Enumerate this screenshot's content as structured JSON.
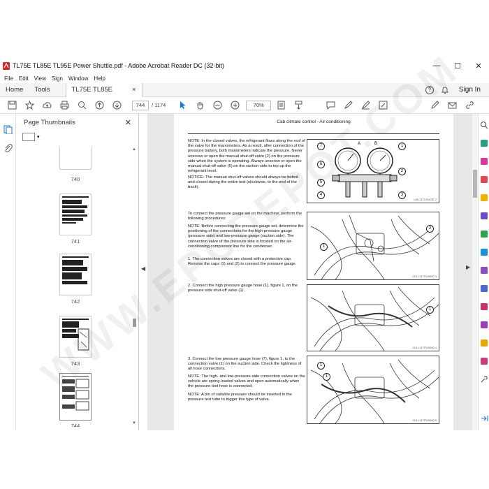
{
  "window": {
    "title": "TL75E TL85E TL95E Power Shuttle.pdf - Adobe Acrobat Reader DC (32-bit)",
    "minimize": "—",
    "maximize": "☐",
    "close": "✕"
  },
  "menu": [
    "File",
    "Edit",
    "View",
    "Sign",
    "Window",
    "Help"
  ],
  "tabs": {
    "home": "Home",
    "tools": "Tools",
    "doc": "TL75E TL85E TL95E...",
    "doc_close": "×",
    "help": "?",
    "bell": "🔔",
    "signin": "Sign In"
  },
  "toolbar": {
    "page_current": "744",
    "page_total": "/ 1174",
    "zoom": "70%"
  },
  "panel": {
    "title": "Page Thumbnails",
    "close": "✕",
    "thumbnails": [
      "740",
      "741",
      "742",
      "743",
      "744"
    ]
  },
  "document": {
    "header": "Cab climate control - Air conditioning",
    "note1": "NOTE: In the closed valves, the refrigerant flows along the roof of the valve for the manometers. As a result, after connection of the pressure battery, both manometers indicate the pressure. Never unscrew or open the manual shut-off valve (2) on the pressure side when the system is operating. Always unscrew or open the manual shut-off valve (6) on the suction side to top up the refrigerant level.",
    "notice": "NOTICE: The manual shut-off valves should always be bolted and closed during the entire test (clockwise, to the end of the track).",
    "intro": "To connect the pressure gauge set on the machine, perform the following procedures:",
    "note2": "NOTE: Before connecting the pressure gauge set, determine the positioning of the connections for the high-pressure gauge (pressure side) and low-pressure gauge (suction side). The connection valve of the pressure side is located on the air-conditioning compressor line for the condenser.",
    "step1_num": "1.",
    "step1": "The connection valves are closed with a protective cap. Remove the caps (1) and (2) to connect the pressure gauge.",
    "step2_num": "2.",
    "step2": "Connect the high pressure gauge hose (1), figure 1, on the pressure side shut-off valve (1).",
    "step3_num": "3.",
    "step3": "Connect the low pressure gauge hose (7), figure 1, to the connection valve (1) on the suction side. Check the tightness of all hose connections.",
    "note3": "NOTE: The high- and low-pressure-side connection valves on the vehicle are spring-loaded valves and open automatically when the pressure test hose is connected.",
    "note4": "NOTE: A pin of suitable pressure should be inserted in the pressure test tube to trigger this type of valve.",
    "fig1_caption": "LAIL11TL00ASE  2",
    "fig2_caption": "CULL11TPU0000  3",
    "fig3_caption": "CULL11TPU0000  4",
    "fig4_caption": "CULL11TPU0000  5",
    "gauge_a": "A",
    "gauge_b": "B",
    "callouts": [
      "7",
      "1",
      "6",
      "2",
      "5",
      "3",
      "4",
      "2",
      "1",
      "1",
      "1",
      "1"
    ]
  },
  "watermark": "WWW.EPCDEPOT.COM"
}
